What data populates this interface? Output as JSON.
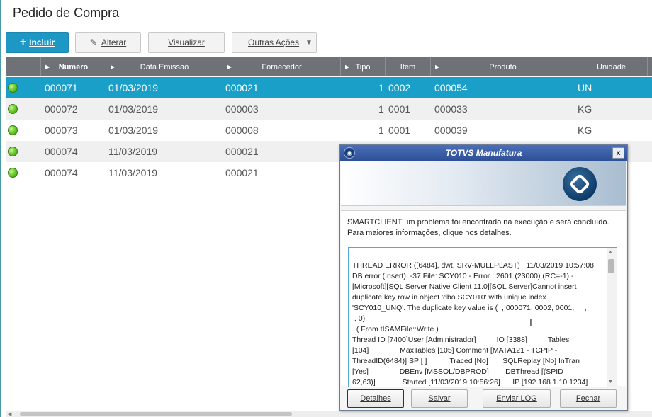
{
  "page": {
    "title": "Pedido de Compra"
  },
  "toolbar": {
    "incluir": "Incluir",
    "alterar": "Alterar",
    "visualizar": "Visualizar",
    "outras": "Outras Ações"
  },
  "grid": {
    "headers": {
      "numero": "Numero",
      "data": "Data Emissao",
      "fornecedor": "Fornecedor",
      "tipo": "Tipo",
      "item": "Item",
      "produto": "Produto",
      "unidade": "Unidade"
    },
    "rows": [
      {
        "numero": "000071",
        "data": "01/03/2019",
        "fornecedor": "000021",
        "tipo": "1",
        "item": "0002",
        "produto": "000054",
        "unidade": "UN"
      },
      {
        "numero": "000072",
        "data": "01/03/2019",
        "fornecedor": "000003",
        "tipo": "1",
        "item": "0001",
        "produto": "000033",
        "unidade": "KG"
      },
      {
        "numero": "000073",
        "data": "01/03/2019",
        "fornecedor": "000008",
        "tipo": "1",
        "item": "0001",
        "produto": "000039",
        "unidade": "KG"
      },
      {
        "numero": "000074",
        "data": "11/03/2019",
        "fornecedor": "000021",
        "tipo": "",
        "item": "",
        "produto": "",
        "unidade": ""
      },
      {
        "numero": "000074",
        "data": "11/03/2019",
        "fornecedor": "000021",
        "tipo": "",
        "item": "",
        "produto": "",
        "unidade": ""
      }
    ],
    "selected_row": 0,
    "status_color": "#6fcf2a"
  },
  "dialog": {
    "title": "TOTVS Manufatura",
    "close": "x",
    "message_line1": "SMARTCLIENT um problema foi encontrado na execução e será concluído.",
    "message_line2": "Para maiores informações, clique nos detalhes.",
    "log": "THREAD ERROR ([6484], dwt, SRV-MULLPLAST)   11/03/2019 10:57:08\nDB error (Insert): -37 File: SCY010 - Error : 2601 (23000) (RC=-1) -\n[Microsoft][SQL Server Native Client 11.0][SQL Server]Cannot insert\nduplicate key row in object 'dbo.SCY010' with unique index\n'SCY010_UNQ'. The duplicate key value is (  , 000071, 0002, 0001,     ,\n , 0).\n  ( From tISAMFile::Write )\nThread ID [7400]User [Administrador]          IO [3388]          Tables\n[104]               MaxTables [105] Comment [MATA121 - TCPIP -\nThreadID(6484)] SP [ ]           Traced [No]       SQLReplay [No] InTran\n[Yes]               DBEnv [MSSQL/DBPROD]        DBThread [(SPID\n62,63)]             Started [11/03/2019 10:56:26]      IP [192.168.1.10:1234]",
    "buttons": {
      "detalhes": "Detalhes",
      "salvar": "Salvar",
      "enviar_log": "Enviar LOG",
      "fechar": "Fechar"
    }
  }
}
